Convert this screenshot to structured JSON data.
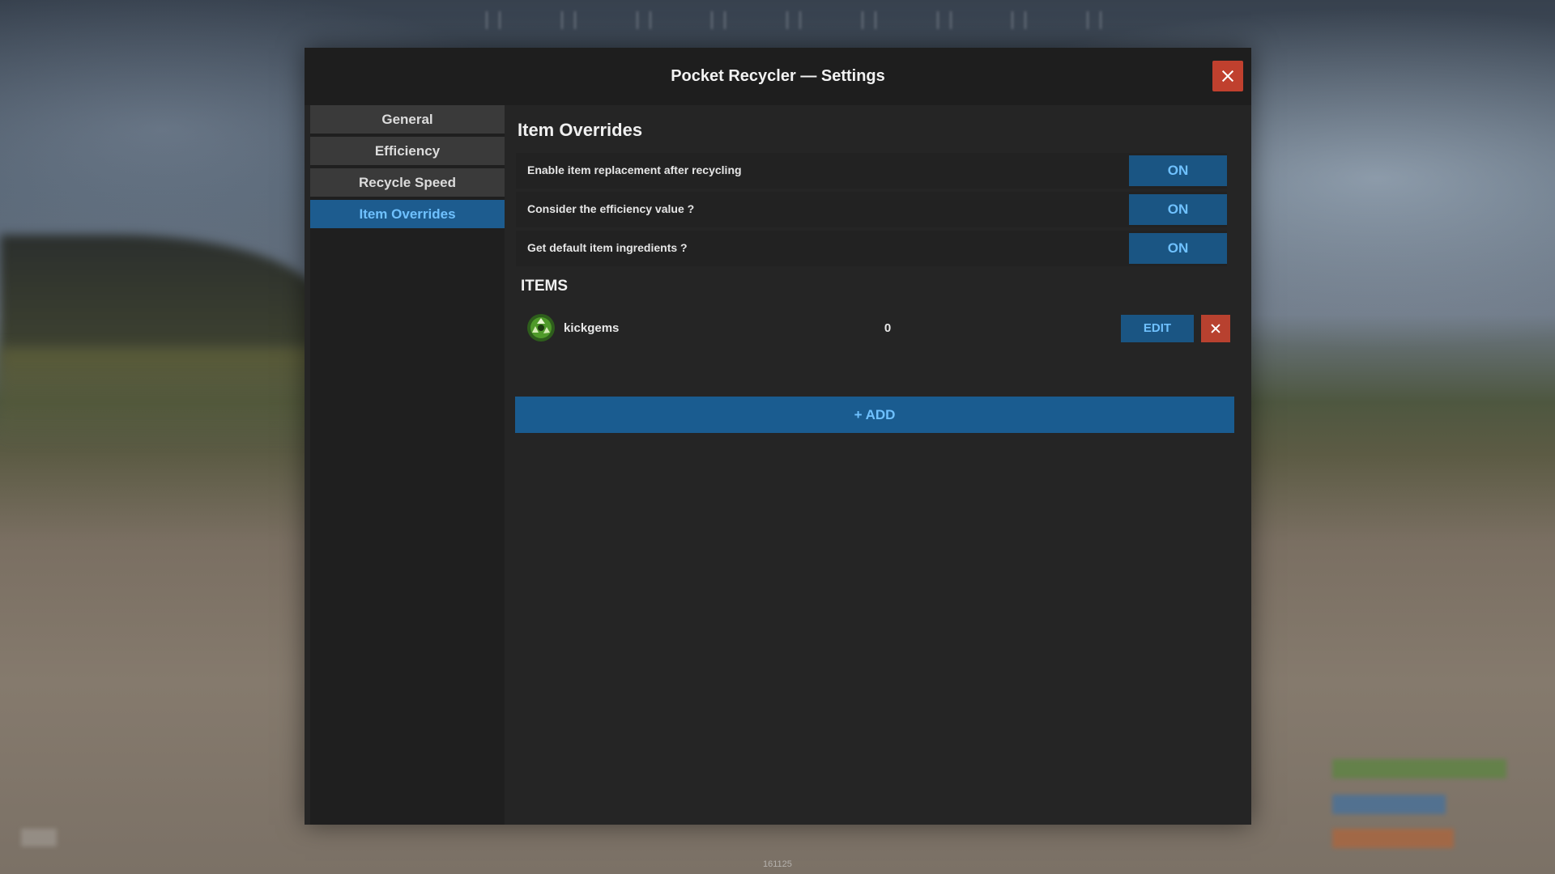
{
  "window": {
    "title": "Pocket Recycler — Settings"
  },
  "sidebar": {
    "items": [
      {
        "label": "General",
        "active": false
      },
      {
        "label": "Efficiency",
        "active": false
      },
      {
        "label": "Recycle Speed",
        "active": false
      },
      {
        "label": "Item Overrides",
        "active": true
      }
    ]
  },
  "main": {
    "section_title": "Item Overrides",
    "toggles": [
      {
        "label": "Enable item replacement after recycling",
        "value": "ON"
      },
      {
        "label": "Consider the efficiency value ?",
        "value": "ON"
      },
      {
        "label": "Get default item ingredients ?",
        "value": "ON"
      }
    ],
    "items_title": "ITEMS",
    "items": [
      {
        "name": "kickgems",
        "count": "0",
        "icon": "recycle-icon",
        "edit_label": "EDIT"
      }
    ],
    "add_label": "+ ADD"
  },
  "footer": {
    "version": "161125"
  },
  "colors": {
    "accent": "#1a5583",
    "accent_text": "#6fc1ff",
    "danger": "#c0402e",
    "panel": "#252525"
  }
}
